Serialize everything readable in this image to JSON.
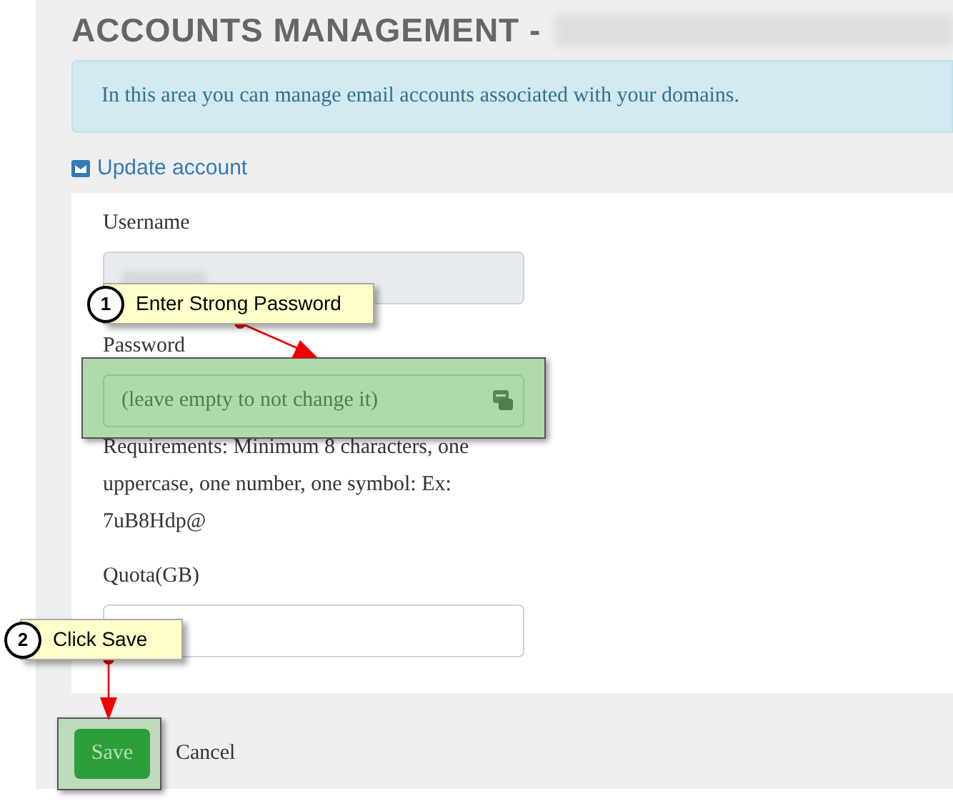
{
  "page_title": "ACCOUNTS MANAGEMENT -",
  "info_message": "In this area you can manage email accounts associated with your domains.",
  "section_link": "Update account",
  "form": {
    "fields": [
      {
        "kind": "readonly",
        "label": "Username"
      },
      {
        "kind": "password",
        "label": "Password",
        "placeholder": "(leave empty to not change it)",
        "help": "Requirements: Minimum 8 characters, one uppercase, one number, one symbol: Ex: 7uB8Hdp@"
      },
      {
        "kind": "text",
        "label": "Quota(GB)"
      }
    ]
  },
  "buttons": {
    "save": "Save",
    "cancel": "Cancel"
  },
  "callouts": [
    {
      "number": "1",
      "text": "Enter Strong Password"
    },
    {
      "number": "2",
      "text": "Click Save"
    }
  ]
}
